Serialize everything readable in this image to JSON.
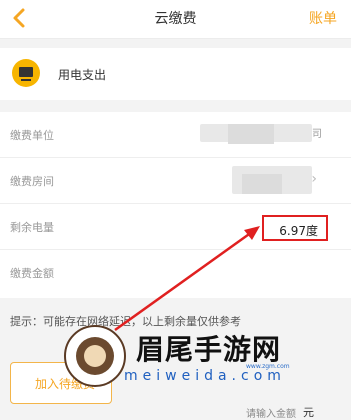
{
  "header": {
    "title": "云缴费",
    "bill_link": "账单"
  },
  "category": {
    "label": "用电支出",
    "icon": "tv-icon"
  },
  "form": {
    "unit_label": "缴费单位",
    "unit_value_tail": "司",
    "room_label": "缴费房间",
    "remaining_label": "剩余电量",
    "remaining_value": "6.97度",
    "amount_label": "缴费金额",
    "amount_placeholder": "请输入金额",
    "amount_unit": "元"
  },
  "hint": "提示：可能存在网络延迟，以上剩余量仅供参考",
  "actions": {
    "add_to_pay": "加入待缴费"
  },
  "watermark": {
    "text": "眉尾手游网",
    "url": "meiweida.com",
    "url_small": "www.zgm.com"
  },
  "colors": {
    "accent": "#f5a623",
    "highlight": "#e02020"
  }
}
